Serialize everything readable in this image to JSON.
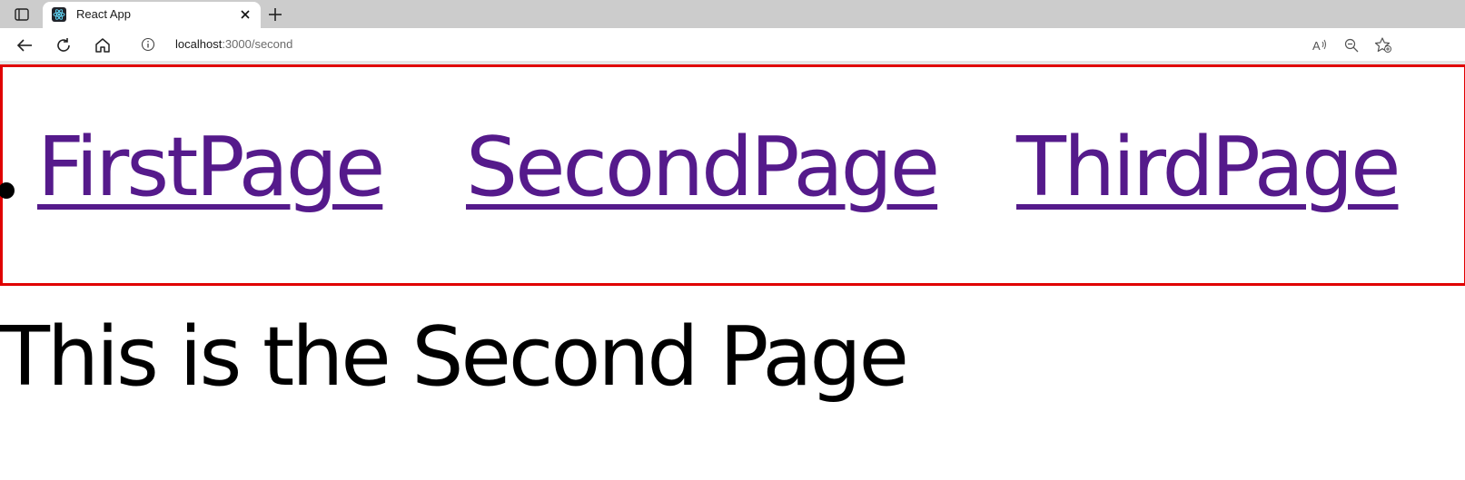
{
  "browser": {
    "tab_title": "React App",
    "url_host": "localhost",
    "url_path": ":3000/second",
    "icons": {
      "tab_actions": "tab-actions-icon",
      "favicon": "react-logo-icon",
      "tab_close": "close-icon",
      "new_tab": "plus-icon",
      "back": "back-arrow-icon",
      "refresh": "refresh-icon",
      "home": "home-icon",
      "site_info": "info-icon",
      "read_aloud": "read-aloud-icon",
      "zoom": "zoom-out-icon",
      "favorites": "add-favorite-icon"
    }
  },
  "page": {
    "nav": {
      "links": [
        "FirstPage",
        "SecondPage",
        "ThirdPage"
      ],
      "border_color": "#e00000",
      "link_color": "#551a8b"
    },
    "heading": "This is the Second Page"
  }
}
